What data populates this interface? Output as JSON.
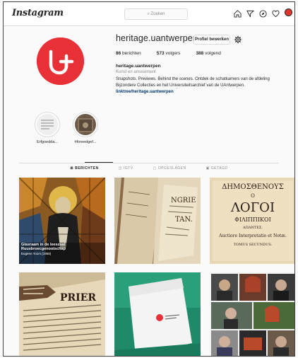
{
  "nav": {
    "logo": "Instagram",
    "search_placeholder": "Zoeken",
    "icons": [
      "home-icon",
      "direct-icon",
      "explore-icon",
      "activity-icon",
      "profile-avatar"
    ]
  },
  "profile": {
    "username": "heritage.uantwerpen",
    "edit_label": "Profiel bewerken",
    "stats": {
      "posts": "86",
      "posts_label": "berichten",
      "followers": "573",
      "followers_label": "volgers",
      "following": "388",
      "following_label": "volgend"
    },
    "fullname": "heritage.uantwerpen",
    "category": "Kunst en amusement",
    "bio": "Snapshots. Previews. Behind the scenes. Ontdek de schatkamers van de afdeling Bijzondere Collecties en het Universiteitsarchief van de UAntwerpen.",
    "link": "linktree/heritage.uantwerpen"
  },
  "highlights": [
    {
      "label": "Erfgoedda..."
    },
    {
      "label": "#foreedgef..."
    }
  ],
  "tabs": [
    {
      "label": "BERICHTEN",
      "active": true
    },
    {
      "label": "IGTV",
      "active": false
    },
    {
      "label": "OPGESLAGEN",
      "active": false
    },
    {
      "label": "GETAGD",
      "active": false
    }
  ],
  "posts": [
    {
      "caption": "Glasraam in de leeszaal Ruusbroecgenootschap",
      "subcaption": "Eugeen Yoors (1958)"
    },
    {
      "caption": ""
    },
    {
      "caption": ""
    },
    {
      "caption": ""
    },
    {
      "caption": ""
    },
    {
      "caption": ""
    }
  ],
  "post3_text": {
    "line1": "ΔΗΜΟΣΘΕΝΟΥΣ",
    "line2": "Ο",
    "line3": "ΛΟΓΟΙ",
    "line4": "ΦΙΛΙΠΠΙΚΟΙ",
    "line5": "ΑΠΑΝΤΕΣ.",
    "line6": "Auctiore Interpretatio et Notæ.",
    "line7": "TOMUS SECUNDUS."
  },
  "post2_text": {
    "line1": "NGRIE",
    "line2": "TAN."
  },
  "post4_text": {
    "line1": "PRIER"
  },
  "colors": {
    "brand": "#e73136",
    "link": "#00376b",
    "border": "#dbdbdb"
  }
}
